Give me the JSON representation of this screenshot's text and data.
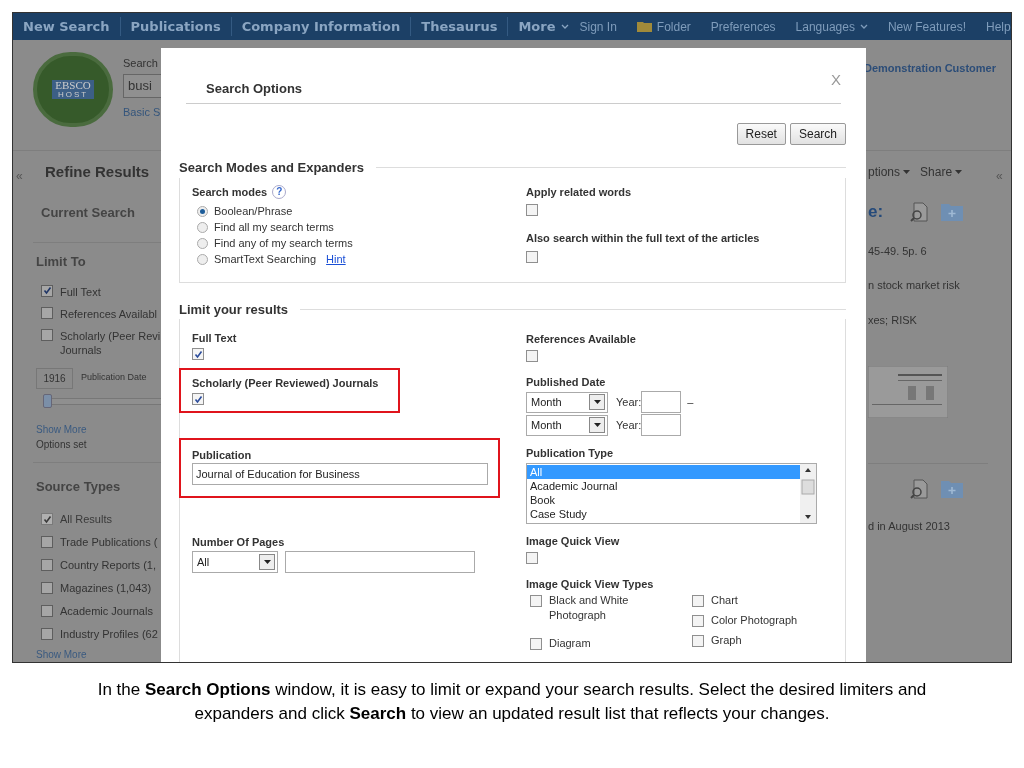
{
  "nav": {
    "left": [
      {
        "label": "New Search",
        "menu": false
      },
      {
        "label": "Publications",
        "menu": false
      },
      {
        "label": "Company Information",
        "menu": false
      },
      {
        "label": "Thesaurus",
        "menu": false
      },
      {
        "label": "More",
        "menu": true
      }
    ],
    "right": [
      {
        "label": "Sign In",
        "kind": "link",
        "menu": false
      },
      {
        "label": "Folder",
        "kind": "folder",
        "menu": false
      },
      {
        "label": "Preferences",
        "kind": "link",
        "menu": false
      },
      {
        "label": "Languages",
        "kind": "link",
        "menu": true
      },
      {
        "label": "New Features!",
        "kind": "link",
        "menu": false
      },
      {
        "label": "Help",
        "kind": "link",
        "menu": false
      }
    ]
  },
  "header": {
    "logo": "EBSCO",
    "logo_sub": "HOST",
    "search_label": "Search",
    "search_value": "busi",
    "basic_link": "Basic S",
    "account": "Demonstration Customer"
  },
  "sidebar": {
    "collapse": "«",
    "title": "Refine Results",
    "current_search": "Current Search",
    "limit_title": "Limit To",
    "limits": [
      {
        "lines": [
          "Full Text"
        ],
        "checked": true
      },
      {
        "lines": [
          "References Availabl"
        ],
        "checked": false
      },
      {
        "lines": [
          "Scholarly (Peer Revi",
          "Journals"
        ],
        "checked": false
      }
    ],
    "date_from": "1916",
    "date_label": "Publication Date",
    "date_slider": {
      "level": 0
    },
    "show_more": "Show More",
    "options_set": "Options set",
    "source_title": "Source Types",
    "sources": [
      {
        "label": "All Results",
        "checked": true,
        "disabled": true
      },
      {
        "label": "Trade Publications (",
        "checked": false,
        "disabled": false
      },
      {
        "label": "Country Reports (1,",
        "checked": false,
        "disabled": false
      },
      {
        "label": "Magazines (1,043)",
        "checked": false,
        "disabled": false
      },
      {
        "label": "Academic Journals",
        "checked": false,
        "disabled": false
      },
      {
        "label": "Industry Profiles (62",
        "checked": false,
        "disabled": false
      }
    ],
    "show_more_2": "Show More"
  },
  "results": {
    "toolbar": [
      {
        "label": "ptions",
        "menu": true
      },
      {
        "label": "Share",
        "menu": true
      }
    ],
    "collapse": "«",
    "title_end": "e:",
    "lines": [
      "45-49. 5p. 6",
      "n stock market risk",
      "xes; RISK"
    ],
    "second_line": "d in August 2013"
  },
  "modal": {
    "title": "Search Options",
    "close": "X",
    "buttons": [
      "Reset",
      "Search"
    ],
    "modes_section": {
      "title": "Search Modes and Expanders",
      "modes_label": "Search modes",
      "help": "?",
      "modes": [
        {
          "label": "Boolean/Phrase",
          "selected": true
        },
        {
          "label": "Find all my search terms",
          "selected": false
        },
        {
          "label": "Find any of my search terms",
          "selected": false
        },
        {
          "label": "SmartText Searching",
          "selected": false,
          "link": "Hint"
        }
      ],
      "expanders": [
        {
          "label": "Apply related words",
          "checked": false
        },
        {
          "label": "Also search within the full text of the articles",
          "checked": false
        }
      ]
    },
    "limits_section": {
      "title": "Limit your results",
      "left": [
        {
          "kind": "checkbox",
          "label": "Full Text",
          "checked": true,
          "highlighted": false
        },
        {
          "kind": "checkbox",
          "label": "Scholarly (Peer Reviewed) Journals",
          "checked": true,
          "highlighted": true
        },
        {
          "kind": "text",
          "label": "Publication",
          "value": "Journal of Education for Business",
          "highlighted": true
        },
        {
          "kind": "pages",
          "label": "Number Of Pages",
          "value": "All"
        }
      ],
      "right": [
        {
          "kind": "checkbox",
          "label": "References Available",
          "checked": false
        },
        {
          "kind": "date",
          "label": "Published Date",
          "dash": "–",
          "rows": [
            {
              "month": "Month",
              "year_label": "Year:"
            },
            {
              "month": "Month",
              "year_label": "Year:"
            }
          ]
        },
        {
          "kind": "list",
          "label": "Publication Type",
          "options": [
            {
              "label": "All",
              "selected": true
            },
            {
              "label": "Academic Journal",
              "selected": false
            },
            {
              "label": "Book",
              "selected": false
            },
            {
              "label": "Case Study",
              "selected": false
            }
          ]
        },
        {
          "kind": "checkbox",
          "label": "Image Quick View",
          "checked": false
        },
        {
          "kind": "grid",
          "label": "Image Quick View Types",
          "columns": [
            [
              {
                "label": "Black and White Photograph",
                "checked": false
              },
              {
                "label": "Diagram",
                "checked": false
              }
            ],
            [
              {
                "label": "Chart",
                "checked": false
              },
              {
                "label": "Color Photograph",
                "checked": false
              },
              {
                "label": "Graph",
                "checked": false
              }
            ]
          ]
        }
      ]
    }
  },
  "caption": "In the **Search Options** window, it is easy to limit or expand your search results. Select the desired limiters and expanders and click **Search** to view an updated result list that reflects your changes."
}
